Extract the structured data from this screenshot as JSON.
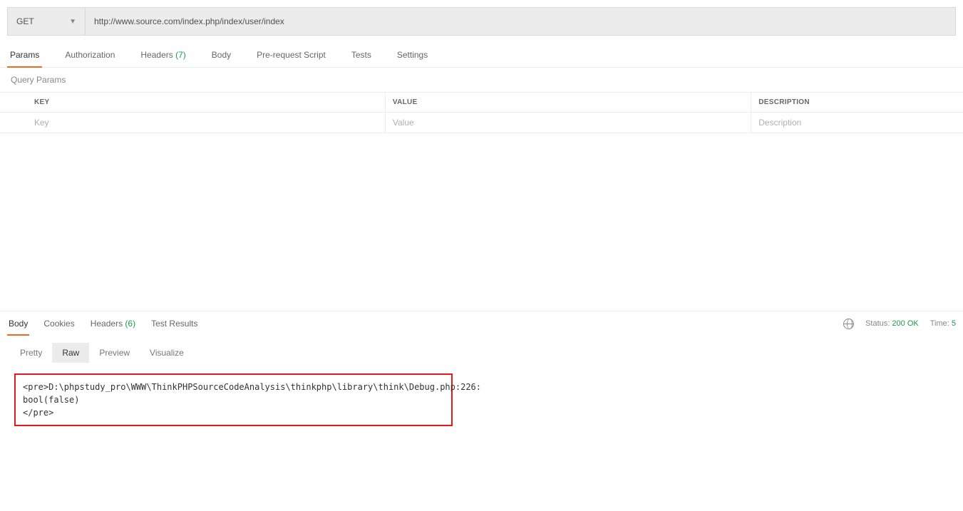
{
  "request": {
    "method": "GET",
    "url": "http://www.source.com/index.php/index/user/index"
  },
  "tabs": {
    "params": "Params",
    "authorization": "Authorization",
    "headers": "Headers",
    "headers_count": "(7)",
    "body": "Body",
    "prerequest": "Pre-request Script",
    "tests": "Tests",
    "settings": "Settings"
  },
  "section": {
    "query_params": "Query Params"
  },
  "columns": {
    "key": "KEY",
    "value": "VALUE",
    "description": "DESCRIPTION"
  },
  "placeholders": {
    "key": "Key",
    "value": "Value",
    "description": "Description"
  },
  "response_tabs": {
    "body": "Body",
    "cookies": "Cookies",
    "headers": "Headers",
    "headers_count": "(6)",
    "test_results": "Test Results"
  },
  "status": {
    "status_label": "Status:",
    "status_value": "200 OK",
    "time_label": "Time:",
    "time_value": "5"
  },
  "view_modes": {
    "pretty": "Pretty",
    "raw": "Raw",
    "preview": "Preview",
    "visualize": "Visualize"
  },
  "response_body": "<pre>D:\\phpstudy_pro\\WWW\\ThinkPHPSourceCodeAnalysis\\thinkphp\\library\\think\\Debug.php:226:\nbool(false)\n</pre>"
}
